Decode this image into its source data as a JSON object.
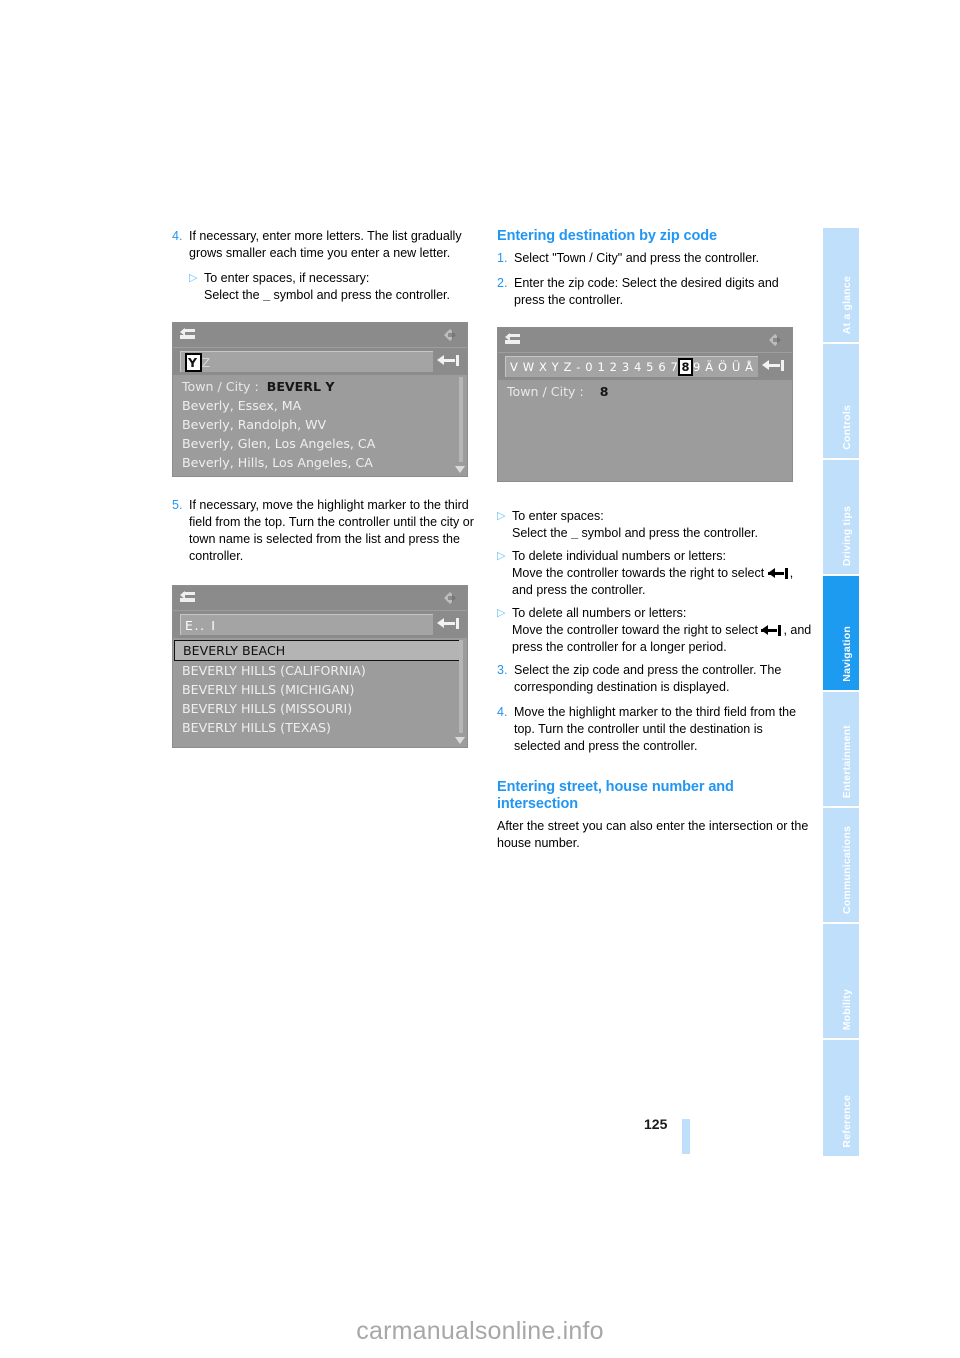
{
  "page": {
    "number": "125",
    "watermark": "carmanualsonline.info"
  },
  "left_column": {
    "step4": {
      "num": "4.",
      "text": "If necessary, enter more letters. The list gradually grows smaller each time you enter a new letter.",
      "bullet": {
        "mark": "▷",
        "line1": "To enter spaces, if necessary:",
        "line2_pre": "Select the ",
        "line2_sym": "_",
        "line2_post": " symbol and press the controller."
      }
    },
    "step5": {
      "num": "5.",
      "text": "If necessary, move the highlight marker to the third field from the top. Turn the controller until the city or town name is selected from the list and press the controller."
    }
  },
  "right_column": {
    "heading_zip": "Entering destination by zip code",
    "step1": {
      "num": "1.",
      "text": "Select \"Town / City\" and press the controller."
    },
    "step2": {
      "num": "2.",
      "text": "Enter the zip code: Select the desired digits and press the controller."
    },
    "bullets": [
      {
        "mark": "▷",
        "line1": "To enter spaces:",
        "line2_pre": "Select the ",
        "line2_sym": "_",
        "line2_post": " symbol and press the controller."
      },
      {
        "mark": "▷",
        "line1": "To delete individual numbers or letters:",
        "line2_pre": "Move the controller towards the right to select ",
        "line2_post": ", and press the controller."
      },
      {
        "mark": "▷",
        "line1": "To delete all numbers or letters:",
        "line2_pre": "Move the controller toward the right to select ",
        "line2_post": ", and press the controller for a longer period."
      }
    ],
    "step3": {
      "num": "3.",
      "text": "Select the zip code and press the controller. The corresponding destination is displayed."
    },
    "step4": {
      "num": "4.",
      "text": "Move the highlight marker to the third field from the top. Turn the controller until the destination is selected and press the controller."
    },
    "heading_street": "Entering street, house number and intersection",
    "para_street": "After the street you can also enter the intersection or the house number."
  },
  "screenshots": {
    "beverly_list": {
      "charstrip": {
        "selected": "Y",
        "after": "Z"
      },
      "rows": [
        {
          "label": "Town / City :",
          "value": "BEVERL Y"
        },
        {
          "label": "Beverly, Essex, MA",
          "value": ""
        },
        {
          "label": "Beverly, Randolph, WV",
          "value": ""
        },
        {
          "label": "Beverly, Glen, Los Angeles, CA",
          "value": ""
        },
        {
          "label": "Beverly, Hills, Los Angeles, CA",
          "value": ""
        }
      ]
    },
    "beverly_hills_list": {
      "charstrip": {
        "text": "E.. I"
      },
      "rows": [
        "BEVERLY BEACH",
        "BEVERLY HILLS (CALIFORNIA)",
        "BEVERLY HILLS (MICHIGAN)",
        "BEVERLY HILLS (MISSOURI)",
        "BEVERLY HILLS (TEXAS)"
      ],
      "highlight_index": 0
    },
    "zip_entry": {
      "charstrip": {
        "before": "V W X Y Z  - 0 1 2 3 4 5 6 7",
        "selected": "8",
        "after": "9 Ä Ö Ü Å"
      },
      "row_label": "Town / City :",
      "row_value": "8"
    }
  },
  "tabs": [
    {
      "label": "At a glance",
      "active": false
    },
    {
      "label": "Controls",
      "active": false
    },
    {
      "label": "Driving tips",
      "active": false
    },
    {
      "label": "Navigation",
      "active": true
    },
    {
      "label": "Entertainment",
      "active": false
    },
    {
      "label": "Communications",
      "active": false
    },
    {
      "label": "Mobility",
      "active": false
    },
    {
      "label": "Reference",
      "active": false
    }
  ]
}
